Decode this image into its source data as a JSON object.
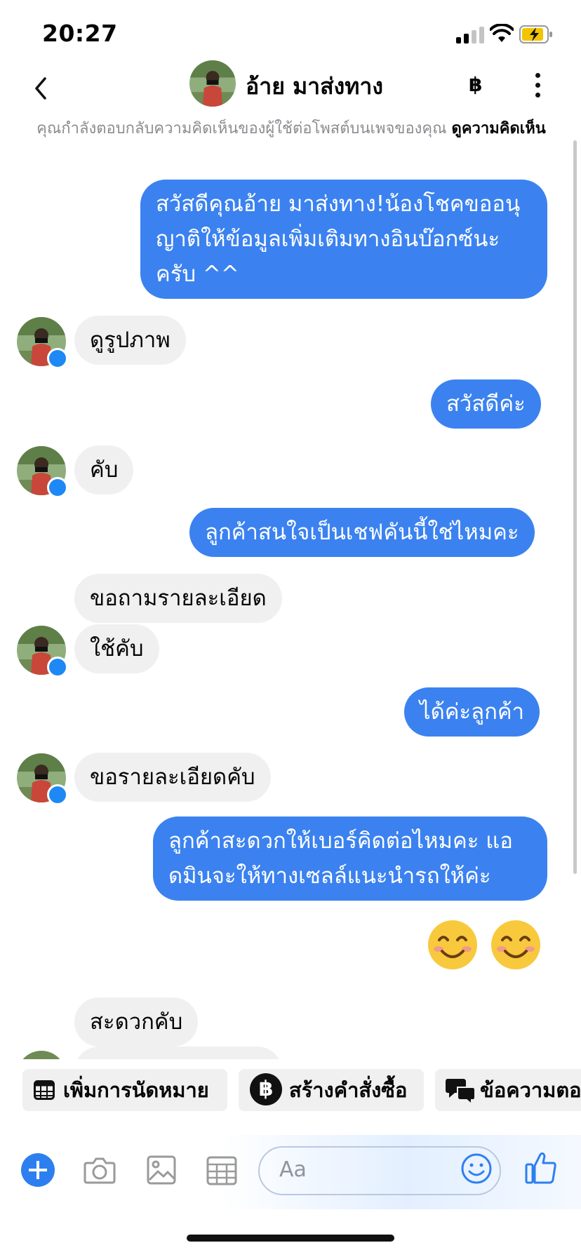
{
  "status_bar": {
    "time": "20:27"
  },
  "header": {
    "contact_name": "อ้าย มาส่งทาง",
    "currency_symbol": "฿"
  },
  "notice": {
    "text": "คุณกำลังตอบกลับความคิดเห็นของผู้ใช้ต่อโพสต์บนเพจของคุณ ",
    "link": "ดูความคิดเห็น"
  },
  "messages": [
    {
      "side": "out",
      "text": "สวัสดีคุณอ้าย มาส่งทาง!น้องโชคขออนุญาติให้ข้อมูลเพิ่มเติมทางอินบ๊อกซ์นะครับ ^^"
    },
    {
      "side": "in",
      "text": "ดูรูปภาพ"
    },
    {
      "side": "out",
      "text": "สวัสดีค่ะ"
    },
    {
      "side": "in",
      "text": "คับ"
    },
    {
      "side": "out",
      "text": "ลูกค้าสนใจเป็นเชฟคันนี้ใช่ไหมคะ"
    },
    {
      "side": "in",
      "text": "ขอถามรายละเอียด"
    },
    {
      "side": "in",
      "text": "ใช้คับ"
    },
    {
      "side": "out",
      "text": "ได้ค่ะลูกค้า"
    },
    {
      "side": "in",
      "text": "ขอรายละเอียดคับ"
    },
    {
      "side": "out",
      "text": "ลูกค้าสะดวกให้เบอร์คิดต่อไหมคะ แอดมินจะให้ทางเซลล์แนะนำรถให้ค่ะ"
    },
    {
      "side": "out",
      "text": "😊 😊"
    },
    {
      "side": "in",
      "text": "สะดวกคับ"
    }
  ],
  "quick_actions": [
    {
      "label": "เพิ่มการนัดหมาย",
      "icon": "calendar-icon"
    },
    {
      "label": "สร้างคำสั่งซื้อ",
      "icon": "baht-icon"
    },
    {
      "label": "ข้อความตอบกลับ",
      "icon": "chat-bubbles-icon"
    }
  ],
  "composer": {
    "placeholder": "Aa"
  },
  "colors": {
    "outgoing_bubble": "#3b82f0",
    "incoming_bubble": "#f0f0f0",
    "accent": "#2d7ff0"
  }
}
